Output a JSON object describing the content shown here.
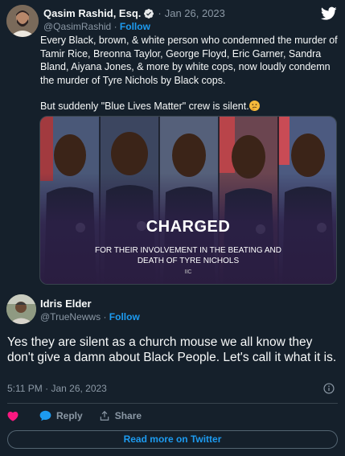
{
  "quoted_tweet": {
    "author_name": "Qasim Rashid, Esq.",
    "date": "Jan 26, 2023",
    "handle": "@QasimRashid",
    "follow_label": "Follow",
    "dot": "·",
    "paragraph1": "Every Black, brown, & white person who condemned the murder of Tamir Rice, Breonna Taylor, George Floyd, Eric Garner, Sandra Bland, Aiyana Jones, & more by white cops, now loudly condemn the murder of Tyre Nichols by Black cops.",
    "paragraph2": "But suddenly \"Blue Lives Matter\" crew is silent.",
    "emoji": "thinking-face",
    "image": {
      "headline": "CHARGED",
      "caption": "FOR THEIR INVOLVEMENT IN THE BEATING AND DEATH OF TYRE NICHOLS",
      "mark": "IIC"
    }
  },
  "reply_tweet": {
    "author_name": "Idris Elder",
    "handle": "@TrueNewws",
    "dot": "·",
    "follow_label": "Follow",
    "text": "Yes they are silent as a church mouse we all know they don't give a damn about Black People. Let's call it what it is.",
    "timestamp": "5:11 PM · Jan 26, 2023"
  },
  "actions": {
    "reply_label": "Reply",
    "share_label": "Share",
    "read_more_label": "Read more on Twitter"
  },
  "colors": {
    "background": "#15202b",
    "accent": "#1d9bf0",
    "like": "#f91880",
    "muted": "#8b98a5"
  }
}
